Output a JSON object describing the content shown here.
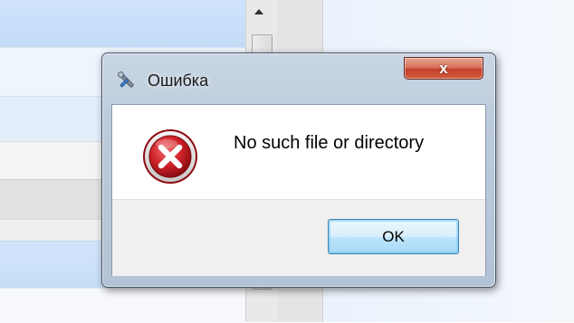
{
  "dialog": {
    "title": "Ошибка",
    "title_icon": "wrench-screwdriver-icon",
    "close_label": "x",
    "message": "No such file or directory",
    "message_icon": "error-icon",
    "ok_label": "OK",
    "colors": {
      "close_button": "#c4402a",
      "error_red": "#d0242a",
      "ok_button": "#bee6fd"
    }
  }
}
